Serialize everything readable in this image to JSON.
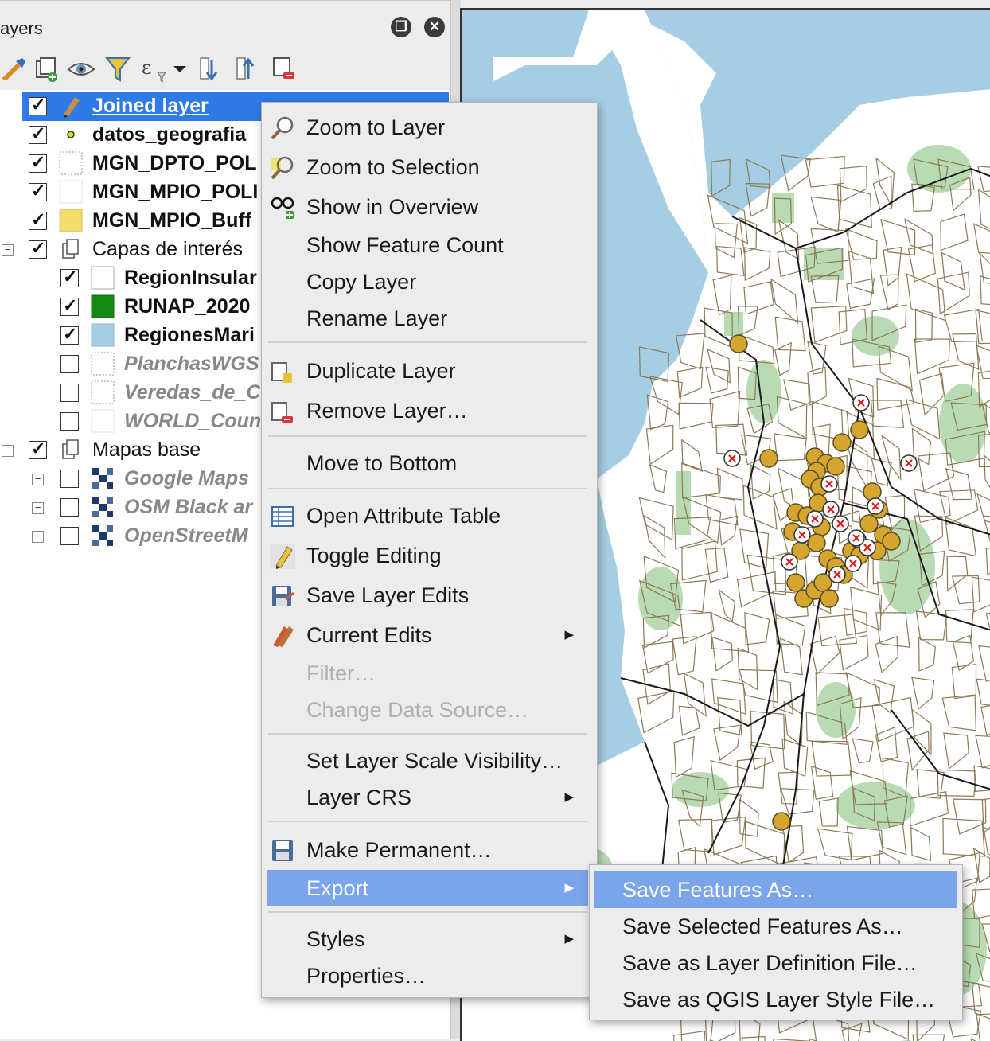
{
  "panel": {
    "title": "ayers",
    "toolbar": [
      "paint-icon",
      "add-group-icon",
      "eye-icon",
      "filter-icon",
      "expression-filter-icon",
      "expand-all-icon",
      "collapse-all-icon",
      "remove-layer-icon"
    ]
  },
  "layers": [
    {
      "label": "Joined layer",
      "checked": true,
      "style": "bold",
      "symbol": "pencil-icon",
      "selected": true
    },
    {
      "label": "datos_geografia",
      "checked": true,
      "style": "bold",
      "symbol": "point-icon"
    },
    {
      "label": "MGN_DPTO_POL",
      "checked": true,
      "style": "bold",
      "symbol": "polygon-dashed-icon"
    },
    {
      "label": "MGN_MPIO_POLI",
      "checked": true,
      "style": "bold",
      "symbol": "polygon-empty-icon"
    },
    {
      "label": "MGN_MPIO_Buff",
      "checked": true,
      "style": "bold",
      "symbol": "polygon-yellow-icon"
    },
    {
      "label": "Capas de interés",
      "checked": true,
      "style": "group",
      "symbol": "group-icon"
    },
    {
      "label": "RegionInsular",
      "checked": true,
      "style": "bold",
      "symbol": "polygon-white-icon"
    },
    {
      "label": "RUNAP_2020",
      "checked": true,
      "style": "bold",
      "symbol": "polygon-green-icon"
    },
    {
      "label": "RegionesMari",
      "checked": true,
      "style": "bold",
      "symbol": "polygon-blue-icon"
    },
    {
      "label": "PlanchasWGS",
      "checked": false,
      "style": "italic",
      "symbol": "polygon-dashed-icon"
    },
    {
      "label": "Veredas_de_C",
      "checked": false,
      "style": "italic",
      "symbol": "polygon-dashed-icon"
    },
    {
      "label": "WORLD_Coun",
      "checked": false,
      "style": "italic",
      "symbol": "polygon-empty-icon"
    },
    {
      "label": "Mapas base",
      "checked": true,
      "style": "group",
      "symbol": "group-icon"
    },
    {
      "label": "Google Maps",
      "checked": false,
      "style": "italic",
      "symbol": "raster-icon"
    },
    {
      "label": "OSM Black ar",
      "checked": false,
      "style": "italic",
      "symbol": "raster-icon"
    },
    {
      "label": "OpenStreetM",
      "checked": false,
      "style": "italic",
      "symbol": "raster-icon"
    }
  ],
  "context_menu": {
    "items": [
      {
        "label": "Zoom to Layer",
        "icon": "zoom-layer-icon"
      },
      {
        "label": "Zoom to Selection",
        "icon": "zoom-selection-icon"
      },
      {
        "label": "Show in Overview",
        "icon": "overview-glasses-icon"
      },
      {
        "label": "Show Feature Count",
        "icon": ""
      },
      {
        "label": "Copy Layer",
        "icon": ""
      },
      {
        "label": "Rename Layer",
        "icon": ""
      },
      {
        "label": "Duplicate Layer",
        "icon": "duplicate-layer-icon"
      },
      {
        "label": "Remove Layer…",
        "icon": "remove-layer-icon"
      },
      {
        "label": "Move to Bottom",
        "icon": ""
      },
      {
        "label": "Open Attribute Table",
        "icon": "attribute-table-icon"
      },
      {
        "label": "Toggle Editing",
        "icon": "pencil-icon"
      },
      {
        "label": "Save Layer Edits",
        "icon": "save-edits-icon"
      },
      {
        "label": "Current Edits",
        "icon": "current-edits-icon",
        "submenu": true
      },
      {
        "label": "Filter…",
        "icon": "",
        "disabled": true
      },
      {
        "label": "Change Data Source…",
        "icon": "",
        "disabled": true
      },
      {
        "label": "Set Layer Scale Visibility…",
        "icon": ""
      },
      {
        "label": "Layer CRS",
        "icon": "",
        "submenu": true
      },
      {
        "label": "Make Permanent…",
        "icon": "save-disk-icon"
      },
      {
        "label": "Export",
        "icon": "",
        "submenu": true,
        "highlighted": true
      },
      {
        "label": "Styles",
        "icon": "",
        "submenu": true
      },
      {
        "label": "Properties…",
        "icon": ""
      }
    ]
  },
  "export_submenu": {
    "items": [
      {
        "label": "Save Features As…",
        "highlighted": true
      },
      {
        "label": "Save Selected Features As…"
      },
      {
        "label": "Save as Layer Definition File…"
      },
      {
        "label": "Save as QGIS Layer Style File…"
      }
    ]
  },
  "colors": {
    "selection": "#2f7ae5",
    "menu_highlight": "#7aa5ea",
    "sea": "#a5cde3",
    "land": "#ffffff",
    "protected_area": "#b9dbb4",
    "boundary": "#8c7a55",
    "point": "#d4a630"
  }
}
